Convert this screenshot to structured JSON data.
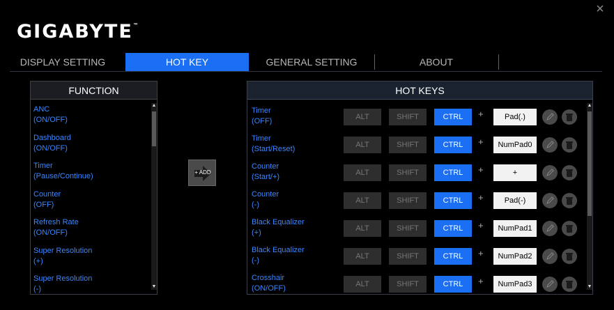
{
  "window": {
    "close_glyph": "×"
  },
  "brand": {
    "logo": "GIGABYTE",
    "trademark": "™"
  },
  "tabs": [
    {
      "label": "DISPLAY SETTING"
    },
    {
      "label": "HOT KEY"
    },
    {
      "label": "GENERAL SETTING"
    },
    {
      "label": "ABOUT"
    }
  ],
  "function_panel": {
    "title": "FUNCTION",
    "items": [
      {
        "line1": "ANC",
        "line2": "(ON/OFF)"
      },
      {
        "line1": "Dashboard",
        "line2": "(ON/OFF)"
      },
      {
        "line1": "Timer",
        "line2": "(Pause/Continue)"
      },
      {
        "line1": "Counter",
        "line2": "(OFF)"
      },
      {
        "line1": "Refresh Rate",
        "line2": "(ON/OFF)"
      },
      {
        "line1": "Super Resolution",
        "line2": "(+)"
      },
      {
        "line1": "Super Resolution",
        "line2": "(-)"
      }
    ]
  },
  "add_button": {
    "label": "+ ADD"
  },
  "hotkeys_panel": {
    "title": "HOT KEYS",
    "rows": [
      {
        "line1": "Timer",
        "line2": "(OFF)",
        "alt": "ALT",
        "shift": "SHIFT",
        "ctrl": "CTRL",
        "plus": "+",
        "key": "Pad(.)"
      },
      {
        "line1": "Timer",
        "line2": "(Start/Reset)",
        "alt": "ALT",
        "shift": "SHIFT",
        "ctrl": "CTRL",
        "plus": "+",
        "key": "NumPad0"
      },
      {
        "line1": "Counter",
        "line2": "(Start/+)",
        "alt": "ALT",
        "shift": "SHIFT",
        "ctrl": "CTRL",
        "plus": "+",
        "key": "+"
      },
      {
        "line1": "Counter",
        "line2": "(-)",
        "alt": "ALT",
        "shift": "SHIFT",
        "ctrl": "CTRL",
        "plus": "+",
        "key": "Pad(-)"
      },
      {
        "line1": "Black Equalizer",
        "line2": "(+)",
        "alt": "ALT",
        "shift": "SHIFT",
        "ctrl": "CTRL",
        "plus": "+",
        "key": "NumPad1"
      },
      {
        "line1": "Black Equalizer",
        "line2": "(-)",
        "alt": "ALT",
        "shift": "SHIFT",
        "ctrl": "CTRL",
        "plus": "+",
        "key": "NumPad2"
      },
      {
        "line1": "Crosshair",
        "line2": "(ON/OFF)",
        "alt": "ALT",
        "shift": "SHIFT",
        "ctrl": "CTRL",
        "plus": "+",
        "key": "NumPad3"
      }
    ]
  },
  "colors": {
    "accent": "#1b6ff5",
    "link": "#3a86ff",
    "background": "#000000"
  }
}
